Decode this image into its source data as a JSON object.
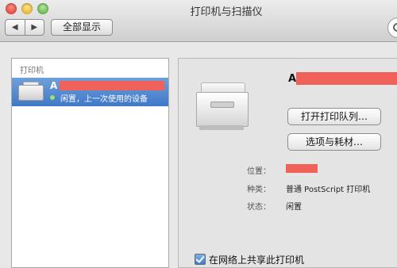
{
  "window": {
    "title": "打印机与扫描仪"
  },
  "toolbar": {
    "back_icon": "◀",
    "forward_icon": "▶",
    "show_all_label": "全部显示"
  },
  "sidebar": {
    "header": "打印机",
    "items": [
      {
        "name": "A",
        "status": "闲置，上一次使用的设备"
      }
    ]
  },
  "detail": {
    "name": "A",
    "open_queue_label": "打开打印队列…",
    "options_label": "选项与耗材…",
    "location_label": "位置：",
    "kind_label": "种类：",
    "kind_value": "普通 PostScript 打印机",
    "status_label": "状态：",
    "status_value": "闲置"
  },
  "share": {
    "label": "在网络上共享此打印机",
    "checked": true
  },
  "colors": {
    "selection": "#3f78c8",
    "redaction": "#f0615a"
  }
}
